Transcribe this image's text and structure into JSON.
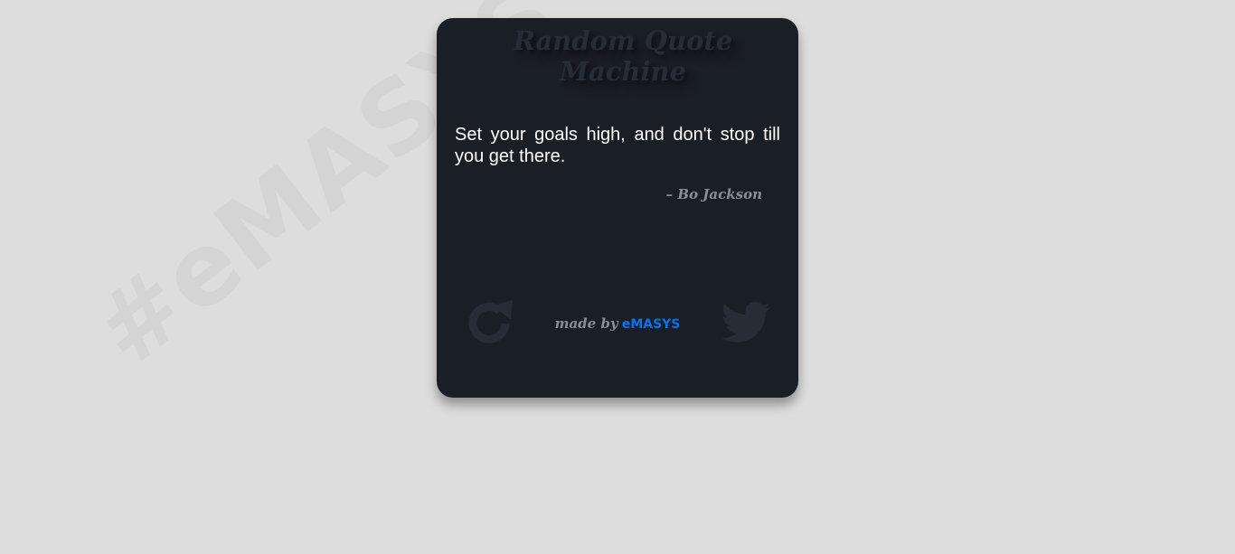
{
  "watermark": "#eMASYS",
  "card": {
    "title": "Random Quote Machine",
    "quote": "Set your goals high, and don't stop till you get there.",
    "author": "– Bo Jackson",
    "refresh_icon": "refresh-icon",
    "tweet_icon": "twitter-icon",
    "credit_prefix": "made by",
    "credit_link": "eMASYS"
  },
  "colors": {
    "background": "#dddddd",
    "card": "#1a1e25",
    "icon": "#262d37",
    "link": "#0a72f0"
  }
}
